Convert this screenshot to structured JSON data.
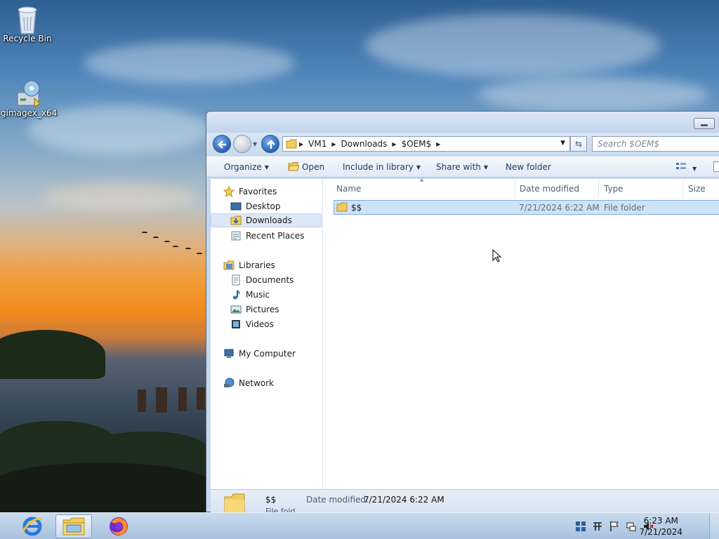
{
  "desktop": {
    "icons": [
      {
        "label": "Recycle Bin",
        "icon": "recycle-bin-icon"
      },
      {
        "label": "gimagex_x64",
        "icon": "gimagex-icon"
      }
    ]
  },
  "explorer": {
    "address": {
      "segments": [
        "VM1",
        "Downloads",
        "$OEM$"
      ]
    },
    "search": {
      "placeholder": "Search $OEM$"
    },
    "toolbar": {
      "organize": "Organize",
      "open": "Open",
      "include_in_library": "Include in library",
      "share_with": "Share with",
      "new_folder": "New folder"
    },
    "navpane": {
      "favorites_header": "Favorites",
      "favorites": [
        "Desktop",
        "Downloads",
        "Recent Places"
      ],
      "libraries_header": "Libraries",
      "libraries": [
        "Documents",
        "Music",
        "Pictures",
        "Videos"
      ],
      "computer": "My Computer",
      "network": "Network",
      "selected": "Downloads"
    },
    "columns": [
      "Name",
      "Date modified",
      "Type",
      "Size"
    ],
    "rows": [
      {
        "name": "$$",
        "date": "7/21/2024 6:22 AM",
        "type": "File folder",
        "size": ""
      }
    ],
    "details": {
      "name": "$$",
      "date_label": "Date modified:",
      "date_value": "7/21/2024 6:22 AM",
      "type": "File fold..."
    }
  },
  "taskbar": {
    "apps": [
      "internet-explorer-icon",
      "file-explorer-icon",
      "firefox-icon"
    ],
    "clock": {
      "time": "6:23 AM",
      "date": "7/21/2024"
    }
  },
  "colors": {
    "selection": "#cde3fa",
    "taskbar": "#b9cfe8",
    "window_frame": "#c7d9ee"
  }
}
